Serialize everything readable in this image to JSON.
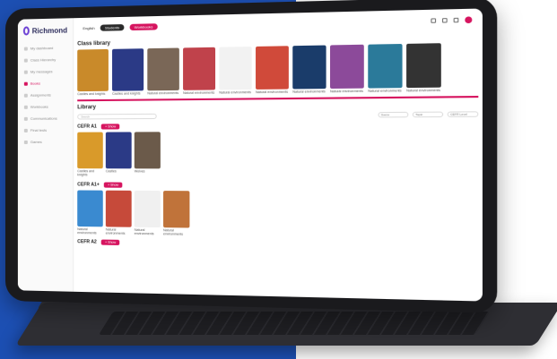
{
  "app": {
    "brand": "Richmond"
  },
  "sidebar": {
    "items": [
      {
        "label": "My dashboard",
        "active": false
      },
      {
        "label": "Class Hierarchy",
        "active": false
      },
      {
        "label": "My messages",
        "active": false
      },
      {
        "label": "Books",
        "active": true
      },
      {
        "label": "Assignments",
        "active": false
      },
      {
        "label": "Workbooks",
        "active": false
      },
      {
        "label": "Communications",
        "active": false
      },
      {
        "label": "Final tests",
        "active": false
      },
      {
        "label": "Games",
        "active": false
      }
    ]
  },
  "topbar": {
    "language": "English",
    "students_label": "Students",
    "teacher_label": "Workbooks"
  },
  "class_library": {
    "title": "Class library",
    "books": [
      {
        "cover_color": "#c98a2a",
        "caption": "Castles and knights"
      },
      {
        "cover_color": "#2b3a86",
        "caption": "Castles and knights"
      },
      {
        "cover_color": "#7a6757",
        "caption": "Natural environments"
      },
      {
        "cover_color": "#c0424b",
        "caption": "Natural environments"
      },
      {
        "cover_color": "#f2f2f2",
        "caption": "Natural environments"
      },
      {
        "cover_color": "#d04a3a",
        "caption": "Natural environments"
      },
      {
        "cover_color": "#1a3c6a",
        "caption": "Natural environments"
      },
      {
        "cover_color": "#8c4a9a",
        "caption": "Natural environments"
      },
      {
        "cover_color": "#2b7a9a",
        "caption": "Natural environments"
      },
      {
        "cover_color": "#333333",
        "caption": "Natural environments"
      }
    ]
  },
  "library": {
    "title": "Library",
    "search_placeholder": "Search",
    "filters": [
      "Genre",
      "Topic",
      "CEFR Level"
    ],
    "show_label": "+ Show",
    "levels": [
      {
        "name": "CEFR A1",
        "books": [
          {
            "cover_color": "#d99a2a",
            "caption": "Castles and knights"
          },
          {
            "cover_color": "#2b3a86",
            "caption": "Castles"
          },
          {
            "cover_color": "#6b5a4a",
            "caption": "Wolves"
          }
        ]
      },
      {
        "name": "CEFR A1+",
        "books": [
          {
            "cover_color": "#3a8ad0",
            "caption": "Natural environments"
          },
          {
            "cover_color": "#c64a3a",
            "caption": "Natural environments"
          },
          {
            "cover_color": "#f0f0f0",
            "caption": "Natural environments"
          },
          {
            "cover_color": "#c0733a",
            "caption": "Natural environments"
          }
        ]
      },
      {
        "name": "CEFR A2",
        "books": []
      }
    ]
  }
}
